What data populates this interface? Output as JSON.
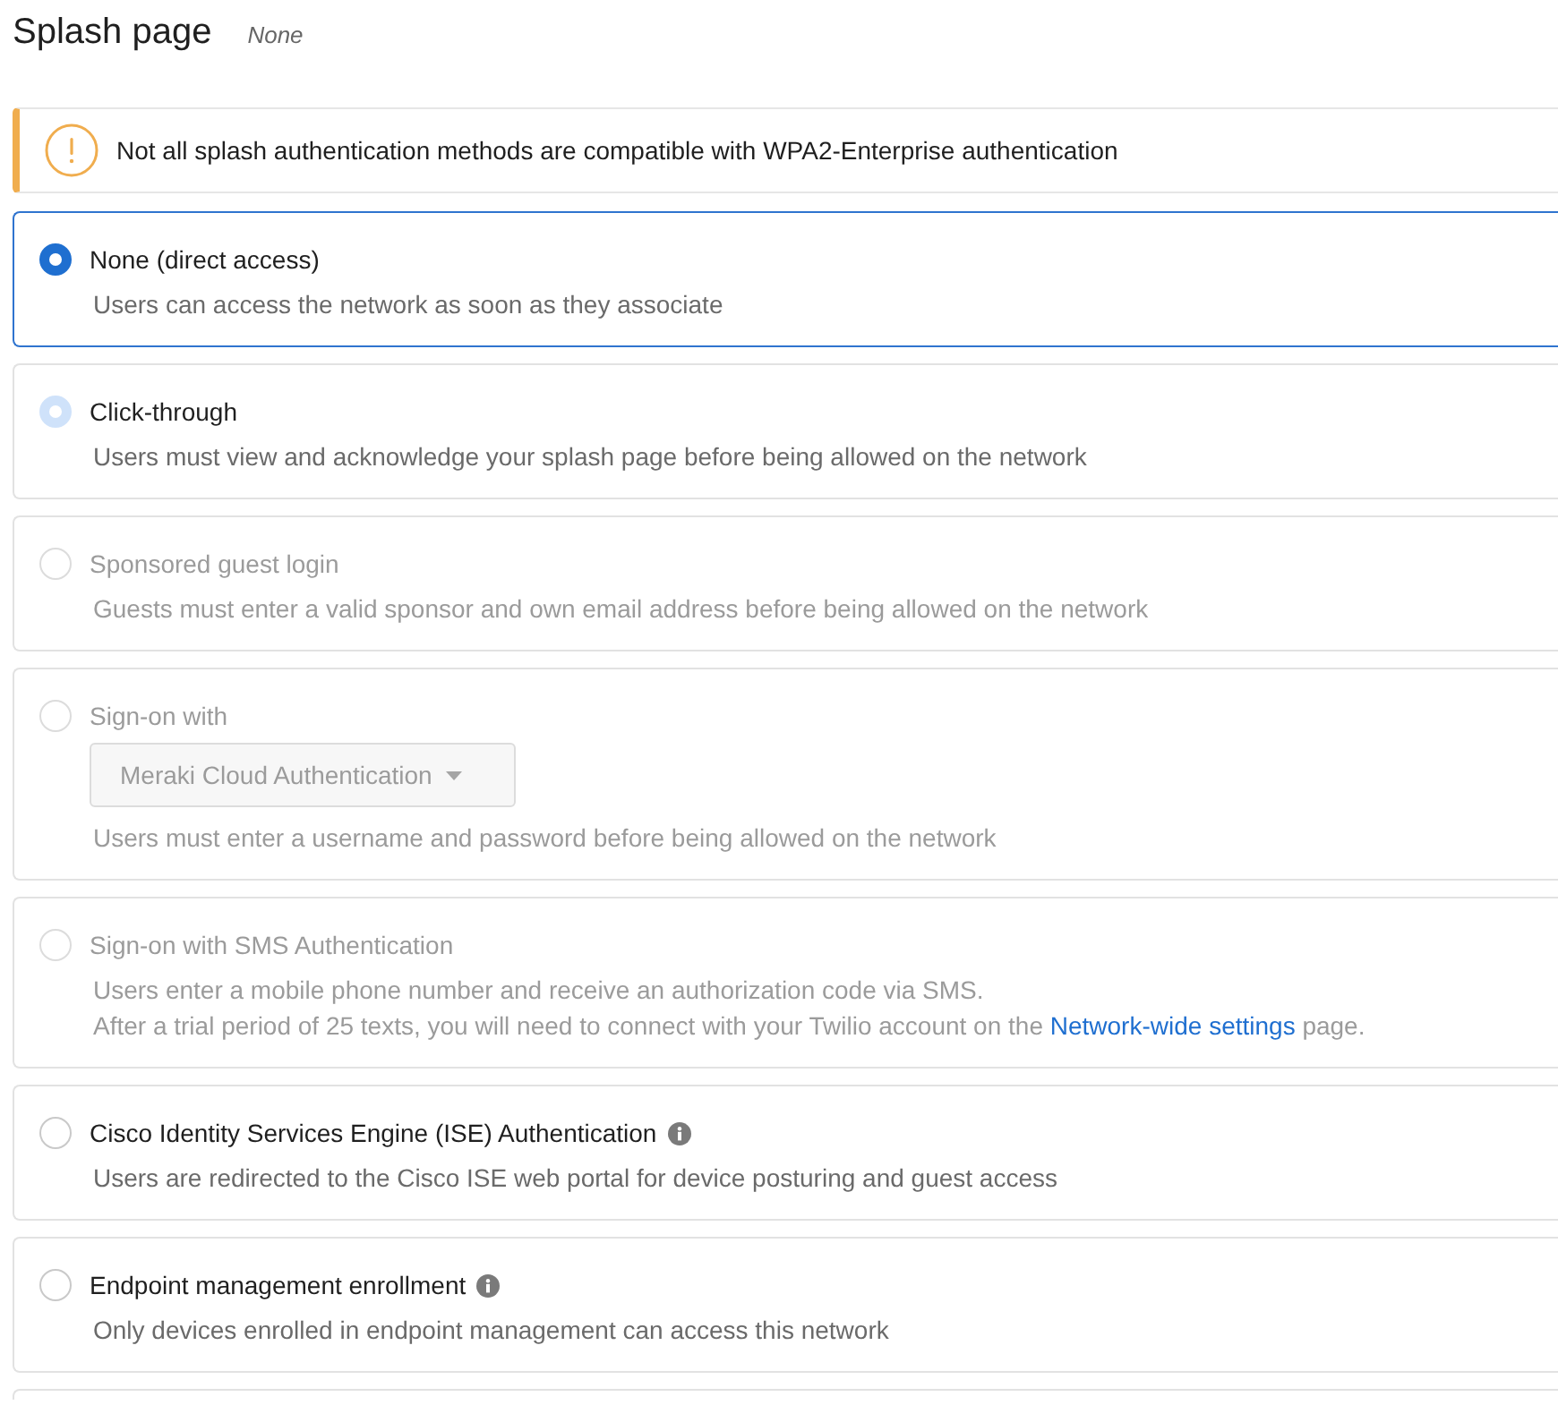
{
  "header": {
    "title": "Splash page",
    "current": "None"
  },
  "alert": {
    "kind": "warning",
    "message": "Not all splash authentication methods are compatible with WPA2-Enterprise authentication"
  },
  "options": [
    {
      "label": "None (direct access)",
      "selected": true,
      "hovered": false,
      "disabled": false,
      "info": false,
      "description": [
        {
          "text": "Users can access the network as soon as they associate"
        }
      ]
    },
    {
      "label": "Click-through",
      "selected": false,
      "hovered": true,
      "disabled": false,
      "info": false,
      "description": [
        {
          "text": "Users must view and acknowledge your splash page before being allowed on the network"
        }
      ]
    },
    {
      "label": "Sponsored guest login",
      "selected": false,
      "hovered": false,
      "disabled": true,
      "info": false,
      "description": [
        {
          "text": "Guests must enter a valid sponsor and own email address before being allowed on the network"
        }
      ]
    },
    {
      "label": "Sign-on with",
      "selected": false,
      "hovered": false,
      "disabled": true,
      "info": false,
      "dropdown": {
        "value": "Meraki Cloud Authentication",
        "disabled": true
      },
      "description": [
        {
          "text": "Users must enter a username and password before being allowed on the network"
        }
      ]
    },
    {
      "label": "Sign-on with SMS Authentication",
      "selected": false,
      "hovered": false,
      "disabled": true,
      "info": false,
      "description": [
        {
          "text": "Users enter a mobile phone number and receive an authorization code via SMS."
        },
        {
          "text": "After a trial period of 25 texts, you will need to connect with your Twilio account on the",
          "link": "Network-wide settings",
          "text_after": "page."
        }
      ]
    },
    {
      "label": "Cisco Identity Services Engine (ISE) Authentication",
      "selected": false,
      "hovered": false,
      "disabled": false,
      "info": true,
      "description": [
        {
          "text": "Users are redirected to the Cisco ISE web portal for device posturing and guest access"
        }
      ]
    },
    {
      "label": "Endpoint management enrollment",
      "selected": false,
      "hovered": false,
      "disabled": false,
      "info": true,
      "description": [
        {
          "text": "Only devices enrolled in endpoint management can access this network"
        }
      ]
    }
  ]
}
